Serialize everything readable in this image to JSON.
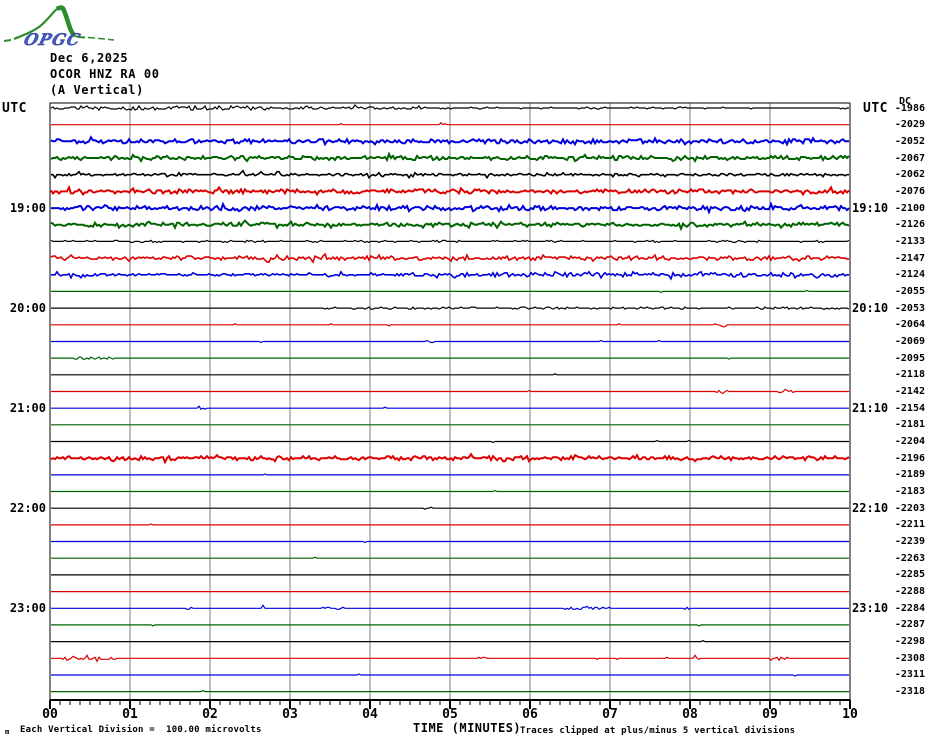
{
  "logo": {
    "text": "OPGC"
  },
  "header": {
    "date": "Dec 6,2025",
    "station": "OCOR HNZ RA 00",
    "component": "(A Vertical)"
  },
  "axes": {
    "utc_left": "UTC",
    "utc_right": "UTC",
    "dc_label": "DC",
    "x_title": "TIME (MINUTES)",
    "x_ticks": [
      "00",
      "01",
      "02",
      "03",
      "04",
      "05",
      "06",
      "07",
      "08",
      "09",
      "10"
    ],
    "left_hour_labels": [
      {
        "row": 7,
        "text": "19:00"
      },
      {
        "row": 13,
        "text": "20:00"
      },
      {
        "row": 19,
        "text": "21:00"
      },
      {
        "row": 25,
        "text": "22:00"
      },
      {
        "row": 31,
        "text": "23:00"
      }
    ],
    "right_hour_labels": [
      {
        "row": 7,
        "text": "19:10"
      },
      {
        "row": 13,
        "text": "20:10"
      },
      {
        "row": 19,
        "text": "21:10"
      },
      {
        "row": 25,
        "text": "22:10"
      },
      {
        "row": 31,
        "text": "23:10"
      }
    ]
  },
  "footer": {
    "mark": "m",
    "scale_note": "Each Vertical Division =  100.00 microvolts",
    "clip_note": "Traces clipped at plus/minus 5 vertical divisions"
  },
  "colors": {
    "trace_black": "#000000",
    "trace_red": "#dd0000",
    "trace_blue": "#0000dd",
    "trace_green": "#006400",
    "grid": "#7f7f7f",
    "frame": "#000000",
    "logo_green": "#2e8b2e",
    "logo_blue": "#4059c8"
  },
  "chart_data": {
    "type": "line",
    "kind": "helicorder-seismogram",
    "title": "OCOR HNZ RA 00 (A Vertical) Dec 6,2025",
    "xlabel": "TIME (MINUTES)",
    "x_range_minutes": [
      0,
      10
    ],
    "x_tick_labels": [
      "00",
      "01",
      "02",
      "03",
      "04",
      "05",
      "06",
      "07",
      "08",
      "09",
      "10"
    ],
    "minutes_per_row": 10,
    "grid": "vertical-minute-lines",
    "microvolts_per_division": "100.00",
    "clip_divisions": 5,
    "color_cycle": [
      "black",
      "red",
      "blue",
      "green"
    ],
    "rows": [
      {
        "start": "18:00",
        "end": "18:10",
        "color": "black",
        "dc": -1986,
        "amp": 0.5,
        "bursts": [
          [
            0,
            2.7,
            1.0
          ],
          [
            2.7,
            4.8,
            0.45
          ]
        ]
      },
      {
        "start": "18:10",
        "end": "18:20",
        "color": "red",
        "dc": -2029,
        "amp": 0.15,
        "bursts": [
          [
            4.85,
            4.95,
            1.2
          ]
        ]
      },
      {
        "start": "18:20",
        "end": "18:30",
        "color": "blue",
        "dc": -2052,
        "amp": 1.5,
        "bursts": []
      },
      {
        "start": "18:30",
        "end": "18:40",
        "color": "green",
        "dc": -2067,
        "amp": 1.4,
        "bursts": []
      },
      {
        "start": "18:40",
        "end": "18:50",
        "color": "black",
        "dc": -2062,
        "amp": 0.9,
        "bursts": []
      },
      {
        "start": "18:50",
        "end": "19:00",
        "color": "red",
        "dc": -2076,
        "amp": 1.5,
        "bursts": []
      },
      {
        "start": "19:00",
        "end": "19:10",
        "color": "blue",
        "dc": -2100,
        "amp": 1.7,
        "bursts": []
      },
      {
        "start": "19:10",
        "end": "19:20",
        "color": "green",
        "dc": -2126,
        "amp": 1.3,
        "bursts": []
      },
      {
        "start": "19:20",
        "end": "19:30",
        "color": "black",
        "dc": -2133,
        "amp": 0.55,
        "bursts": []
      },
      {
        "start": "19:30",
        "end": "19:40",
        "color": "red",
        "dc": -2147,
        "amp": 1.0,
        "bursts": [
          [
            1.5,
            10,
            0.5
          ]
        ]
      },
      {
        "start": "19:40",
        "end": "19:50",
        "color": "blue",
        "dc": -2124,
        "amp": 0.8,
        "bursts": [
          [
            4.5,
            10,
            0.9
          ]
        ]
      },
      {
        "start": "19:50",
        "end": "20:00",
        "color": "green",
        "dc": -2055,
        "amp": 0.18,
        "bursts": []
      },
      {
        "start": "20:00",
        "end": "20:10",
        "color": "black",
        "dc": -2053,
        "amp": 0.18,
        "bursts": [
          [
            3.4,
            10,
            0.45
          ]
        ]
      },
      {
        "start": "20:10",
        "end": "20:20",
        "color": "red",
        "dc": -2064,
        "amp": 0.15,
        "bursts": [
          [
            8.3,
            8.45,
            1.2
          ]
        ]
      },
      {
        "start": "20:20",
        "end": "20:30",
        "color": "blue",
        "dc": -2069,
        "amp": 0.15,
        "bursts": [
          [
            4.7,
            4.8,
            1.2
          ]
        ]
      },
      {
        "start": "20:30",
        "end": "20:40",
        "color": "green",
        "dc": -2095,
        "amp": 0.15,
        "bursts": [
          [
            0.25,
            0.8,
            0.9
          ]
        ]
      },
      {
        "start": "20:40",
        "end": "20:50",
        "color": "black",
        "dc": -2118,
        "amp": 0.13,
        "bursts": []
      },
      {
        "start": "20:50",
        "end": "21:00",
        "color": "red",
        "dc": -2142,
        "amp": 0.15,
        "bursts": [
          [
            8.3,
            8.5,
            0.9
          ],
          [
            9.1,
            9.3,
            0.8
          ]
        ]
      },
      {
        "start": "21:00",
        "end": "21:10",
        "color": "blue",
        "dc": -2154,
        "amp": 0.15,
        "bursts": [
          [
            1.85,
            1.95,
            1.2
          ]
        ]
      },
      {
        "start": "21:10",
        "end": "21:20",
        "color": "green",
        "dc": -2181,
        "amp": 0.13,
        "bursts": []
      },
      {
        "start": "21:20",
        "end": "21:30",
        "color": "black",
        "dc": -2204,
        "amp": 0.13,
        "bursts": []
      },
      {
        "start": "21:30",
        "end": "21:40",
        "color": "red",
        "dc": -2196,
        "amp": 1.3,
        "bursts": []
      },
      {
        "start": "21:40",
        "end": "21:50",
        "color": "blue",
        "dc": -2189,
        "amp": 0.15,
        "bursts": []
      },
      {
        "start": "21:50",
        "end": "22:00",
        "color": "green",
        "dc": -2183,
        "amp": 0.13,
        "bursts": []
      },
      {
        "start": "22:00",
        "end": "22:10",
        "color": "black",
        "dc": -2203,
        "amp": 0.13,
        "bursts": [
          [
            4.65,
            4.78,
            0.8
          ]
        ]
      },
      {
        "start": "22:10",
        "end": "22:20",
        "color": "red",
        "dc": -2211,
        "amp": 0.18,
        "bursts": []
      },
      {
        "start": "22:20",
        "end": "22:30",
        "color": "blue",
        "dc": -2239,
        "amp": 0.13,
        "bursts": []
      },
      {
        "start": "22:30",
        "end": "22:40",
        "color": "green",
        "dc": -2263,
        "amp": 0.13,
        "bursts": []
      },
      {
        "start": "22:40",
        "end": "22:50",
        "color": "black",
        "dc": -2285,
        "amp": 0.13,
        "bursts": []
      },
      {
        "start": "22:50",
        "end": "23:00",
        "color": "red",
        "dc": -2288,
        "amp": 0.13,
        "bursts": []
      },
      {
        "start": "23:00",
        "end": "23:10",
        "color": "blue",
        "dc": -2284,
        "amp": 0.15,
        "bursts": [
          [
            1.7,
            1.8,
            1.0
          ],
          [
            2.6,
            2.7,
            0.9
          ],
          [
            3.3,
            3.7,
            0.9
          ],
          [
            6.4,
            7.0,
            1.0
          ],
          [
            7.9,
            8.0,
            0.9
          ]
        ]
      },
      {
        "start": "23:10",
        "end": "23:20",
        "color": "green",
        "dc": -2287,
        "amp": 0.13,
        "bursts": []
      },
      {
        "start": "23:20",
        "end": "23:30",
        "color": "black",
        "dc": -2298,
        "amp": 0.13,
        "bursts": []
      },
      {
        "start": "23:30",
        "end": "23:40",
        "color": "red",
        "dc": -2308,
        "amp": 0.22,
        "bursts": [
          [
            0.15,
            0.9,
            1.1
          ],
          [
            5.3,
            5.45,
            0.7
          ],
          [
            8.0,
            8.15,
            0.6
          ],
          [
            9.0,
            9.25,
            0.7
          ]
        ]
      },
      {
        "start": "23:40",
        "end": "23:50",
        "color": "blue",
        "dc": -2311,
        "amp": 0.13,
        "bursts": []
      },
      {
        "start": "23:50",
        "end": "24:00",
        "color": "green",
        "dc": -2318,
        "amp": 0.13,
        "bursts": []
      }
    ]
  }
}
